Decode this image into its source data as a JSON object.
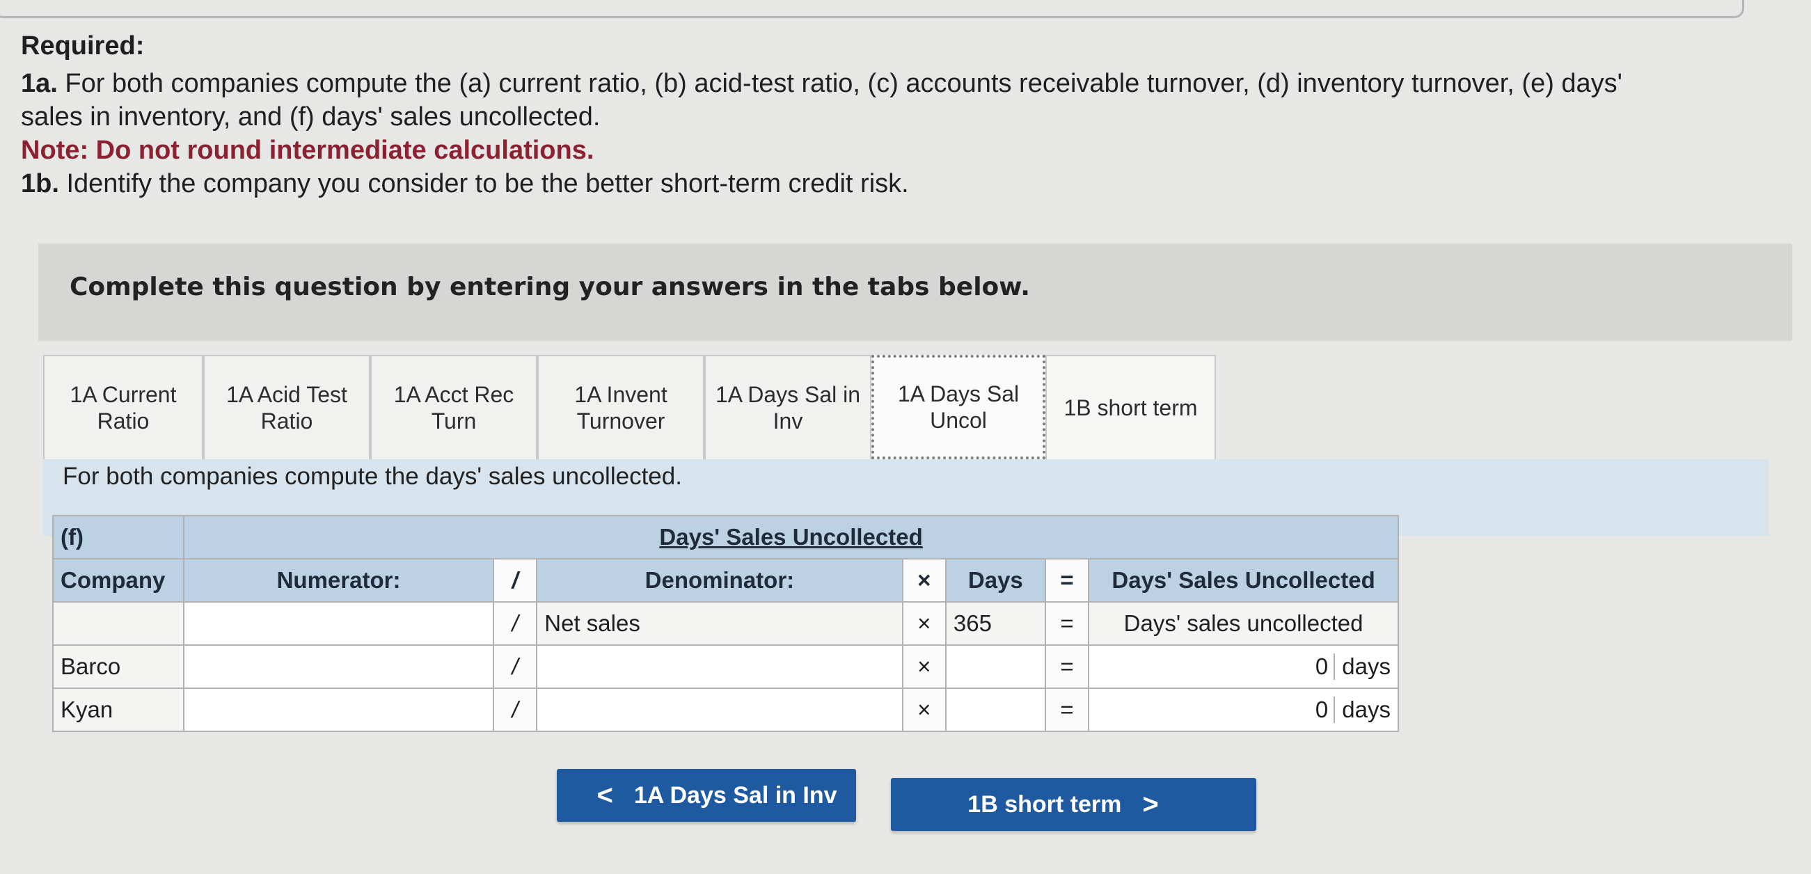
{
  "required": {
    "title": "Required:",
    "line1_label": "1a.",
    "line1_text": " For both companies compute the (a) current ratio, (b) acid-test ratio, (c) accounts receivable turnover, (d) inventory turnover, (e) days'",
    "line1_cont": "sales in inventory, and (f) days' sales uncollected.",
    "note": "Note: Do not round intermediate calculations.",
    "line2_label": "1b.",
    "line2_text": " Identify the company you consider to be the better short-term credit risk."
  },
  "instructions": "Complete this question by entering your answers in the tabs below.",
  "tabs": [
    {
      "line1": "1A Current",
      "line2": "Ratio"
    },
    {
      "line1": "1A Acid Test",
      "line2": "Ratio"
    },
    {
      "line1": "1A Acct Rec",
      "line2": "Turn"
    },
    {
      "line1": "1A Invent",
      "line2": "Turnover"
    },
    {
      "line1": "1A Days Sal in",
      "line2": "Inv"
    },
    {
      "line1": "1A Days Sal",
      "line2": "Uncol"
    },
    {
      "line1": "1B short term",
      "line2": ""
    }
  ],
  "subheading": "For both companies compute the days' sales uncollected.",
  "table": {
    "part": "(f)",
    "title": "Days' Sales Uncollected",
    "col_company": "Company",
    "col_numerator": "Numerator:",
    "slash": "/",
    "col_denominator": "Denominator:",
    "times": "×",
    "col_days": "Days",
    "equals": "=",
    "col_result": "Days' Sales Uncollected",
    "formula_denominator": "Net sales",
    "formula_days": "365",
    "formula_result": "Days' sales uncollected",
    "rows": [
      {
        "company": "Barco",
        "result_value": "0",
        "unit": "days"
      },
      {
        "company": "Kyan",
        "result_value": "0",
        "unit": "days"
      }
    ]
  },
  "nav": {
    "prev_label": "1A Days Sal in Inv",
    "next_label": "1B short term",
    "prev_glyph": "<",
    "next_glyph": ">"
  }
}
